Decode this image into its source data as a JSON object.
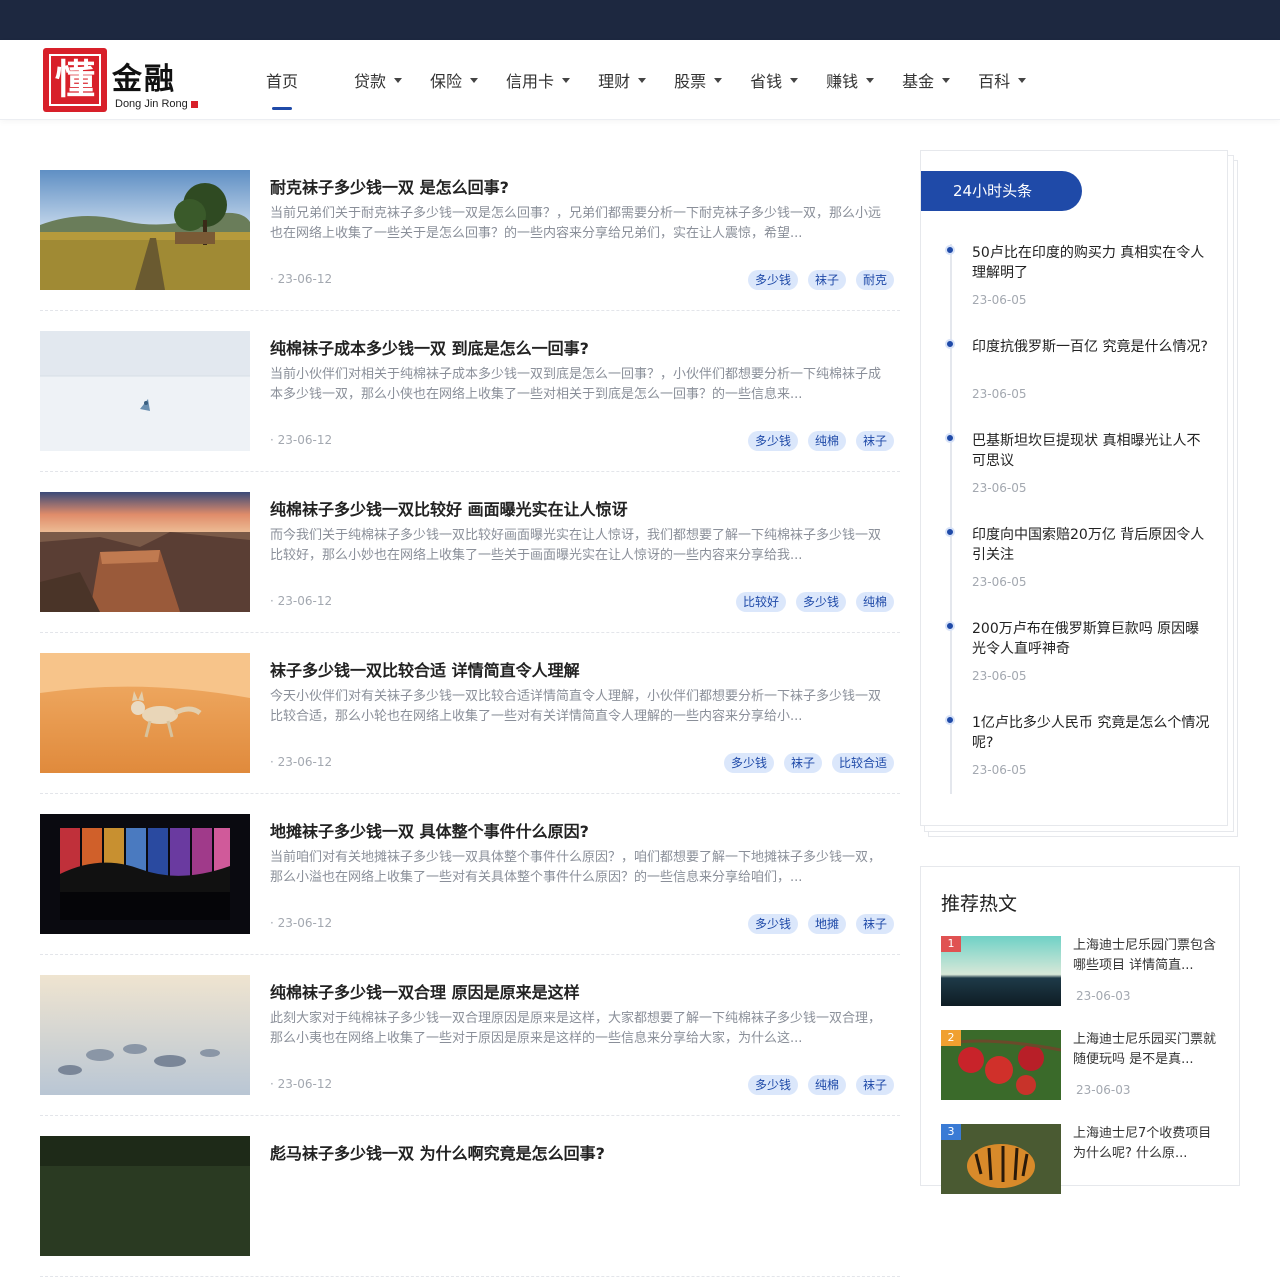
{
  "logo": {
    "seal_char": "懂",
    "text": "金融",
    "sub": "Dong Jin Rong"
  },
  "nav": [
    {
      "label": "首页",
      "dropdown": false,
      "active": true
    },
    {
      "label": "贷款",
      "dropdown": true
    },
    {
      "label": "保险",
      "dropdown": true
    },
    {
      "label": "信用卡",
      "dropdown": true
    },
    {
      "label": "理财",
      "dropdown": true
    },
    {
      "label": "股票",
      "dropdown": true
    },
    {
      "label": "省钱",
      "dropdown": true
    },
    {
      "label": "赚钱",
      "dropdown": true
    },
    {
      "label": "基金",
      "dropdown": true
    },
    {
      "label": "百科",
      "dropdown": true
    }
  ],
  "articles": [
    {
      "title": "耐克袜子多少钱一双 是怎么回事?",
      "summary": "当前兄弟们关于耐克袜子多少钱一双是怎么回事？，兄弟们都需要分析一下耐克袜子多少钱一双，那么小远也在网络上收集了一些关于是怎么回事？的一些内容来分享给兄弟们，实在让人震惊，希望...",
      "date": "· 23-06-12",
      "tags": [
        "多少钱",
        "袜子",
        "耐克"
      ],
      "image": "landscape-field"
    },
    {
      "title": "纯棉袜子成本多少钱一双 到底是怎么一回事?",
      "summary": "当前小伙伴们对相关于纯棉袜子成本多少钱一双到底是怎么一回事？，小伙伴们都想要分析一下纯棉袜子成本多少钱一双，那么小侠也在网络上收集了一些对相关于到底是怎么一回事？的一些信息来...",
      "date": "· 23-06-12",
      "tags": [
        "多少钱",
        "纯棉",
        "袜子"
      ],
      "image": "snow-field"
    },
    {
      "title": "纯棉袜子多少钱一双比较好 画面曝光实在让人惊讶",
      "summary": "而今我们关于纯棉袜子多少钱一双比较好画面曝光实在让人惊讶，我们都想要了解一下纯棉袜子多少钱一双比较好，那么小妙也在网络上收集了一些关于画面曝光实在让人惊讶的一些内容来分享给我...",
      "date": "· 23-06-12",
      "tags": [
        "比较好",
        "多少钱",
        "纯棉"
      ],
      "image": "canyon"
    },
    {
      "title": "袜子多少钱一双比较合适 详情简直令人理解",
      "summary": "今天小伙伴们对有关袜子多少钱一双比较合适详情简直令人理解，小伙伴们都想要分析一下袜子多少钱一双比较合适，那么小轮也在网络上收集了一些对有关详情简直令人理解的一些内容来分享给小...",
      "date": "· 23-06-12",
      "tags": [
        "多少钱",
        "袜子",
        "比较合适"
      ],
      "image": "desert-fox"
    },
    {
      "title": "地摊袜子多少钱一双 具体整个事件什么原因?",
      "summary": "当前咱们对有关地摊袜子多少钱一双具体整个事件什么原因？，咱们都想要了解一下地摊袜子多少钱一双，那么小溢也在网络上收集了一些对有关具体整个事件什么原因？的一些信息来分享给咱们，...",
      "date": "· 23-06-12",
      "tags": [
        "多少钱",
        "地摊",
        "袜子"
      ],
      "image": "color-panels"
    },
    {
      "title": "纯棉袜子多少钱一双合理 原因是原来是这样",
      "summary": "此刻大家对于纯棉袜子多少钱一双合理原因是原来是这样，大家都想要了解一下纯棉袜子多少钱一双合理，那么小夷也在网络上收集了一些对于原因是原来是这样的一些信息来分享给大家，为什么这...",
      "date": "· 23-06-12",
      "tags": [
        "多少钱",
        "纯棉",
        "袜子"
      ],
      "image": "ice-rocks"
    },
    {
      "title": "彪马袜子多少钱一双 为什么啊究竟是怎么回事?",
      "summary": "",
      "date": "",
      "tags": [],
      "image": "forest"
    }
  ],
  "hot": {
    "heading": "24小时头条",
    "items": [
      {
        "title": "50卢比在印度的购买力 真相实在令人理解明了",
        "date": "23-06-05"
      },
      {
        "title": "印度抗俄罗斯一百亿 究竟是什么情况?",
        "date": "23-06-05"
      },
      {
        "title": "巴基斯坦坎巨提现状 真相曝光让人不可思议",
        "date": "23-06-05"
      },
      {
        "title": "印度向中国索赔20万亿 背后原因令人引关注",
        "date": "23-06-05"
      },
      {
        "title": "200万卢布在俄罗斯算巨款吗 原因曝光令人直呼神奇",
        "date": "23-06-05"
      },
      {
        "title": "1亿卢比多少人民币 究竟是怎么个情况呢?",
        "date": "23-06-05"
      }
    ]
  },
  "recommend": {
    "heading": "推荐热文",
    "items": [
      {
        "rank": "1",
        "title": "上海迪士尼乐园门票包含哪些项目 详情简直...",
        "date": "23-06-03",
        "rank_color": "#e05252",
        "image": "sea"
      },
      {
        "rank": "2",
        "title": "上海迪士尼乐园买门票就随便玩吗 是不是真...",
        "date": "23-06-03",
        "rank_color": "#f0a030",
        "image": "apples"
      },
      {
        "rank": "3",
        "title": "上海迪士尼7个收费项目 为什么呢? 什么原...",
        "date": "",
        "rank_color": "#3a7bd5",
        "image": "tiger"
      }
    ]
  },
  "colors": {
    "topbar": "#1d2840",
    "accent": "#1f4aa8",
    "tag_bg": "#dbe7fb",
    "brand_red": "#d8202a"
  }
}
